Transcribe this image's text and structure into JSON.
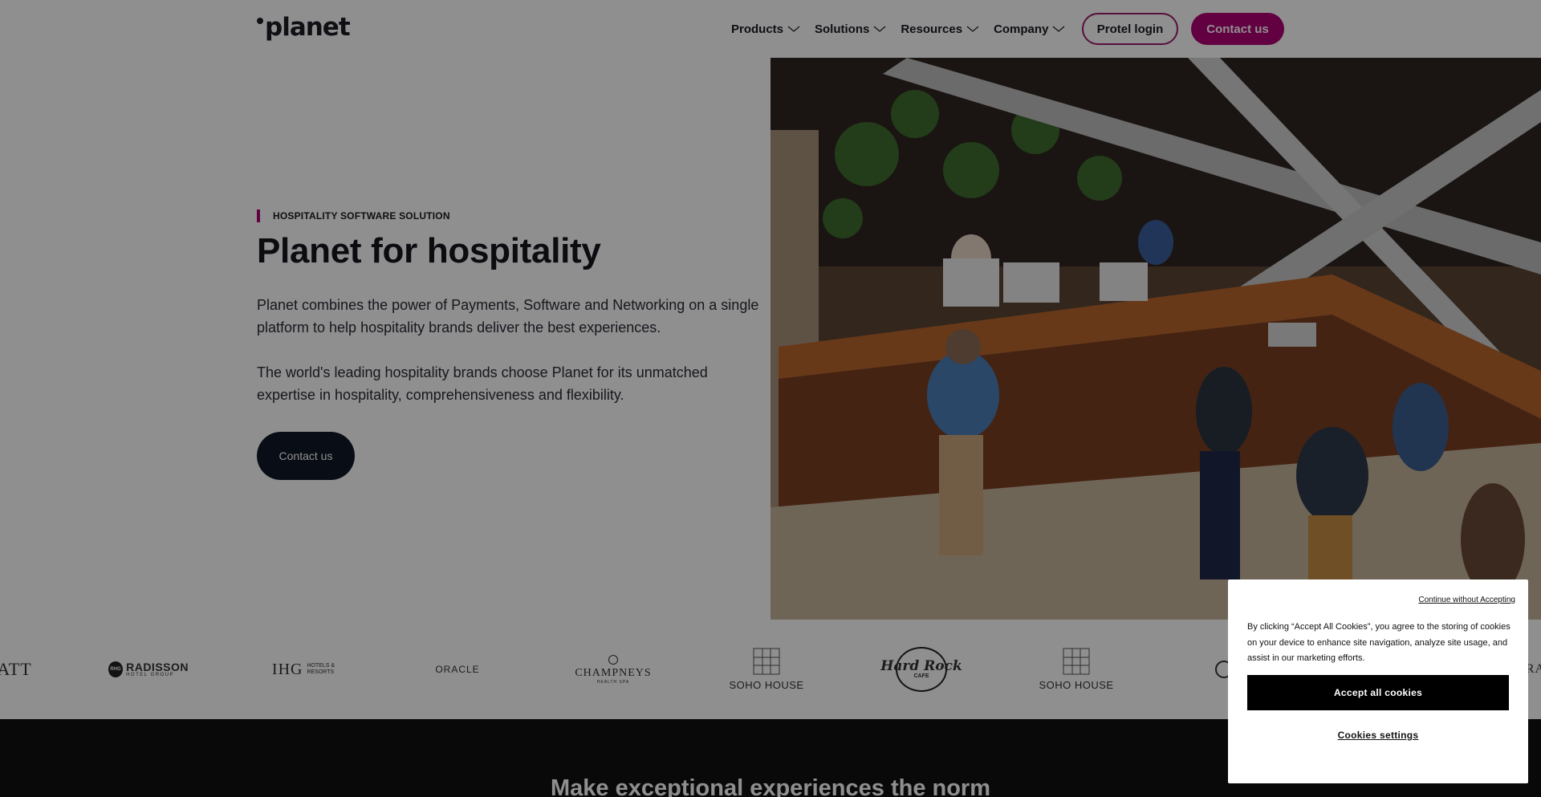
{
  "header": {
    "logo": "planet",
    "nav": [
      "Products",
      "Solutions",
      "Resources",
      "Company"
    ],
    "protel_login": "Protel login",
    "contact": "Contact us"
  },
  "hero": {
    "eyebrow": "HOSPITALITY SOFTWARE SOLUTION",
    "title": "Planet for hospitality",
    "p1": "Planet combines the power of Payments, Software and Networking on a single platform to help hospitality brands deliver the best experiences.",
    "p2": "The world's leading hospitality brands choose Planet for its unmatched expertise in hospitality, comprehensiveness and flexibility.",
    "cta": "Contact us"
  },
  "logos": {
    "hyatt_partial": "ATT",
    "radisson": "RADISSON",
    "radisson_sub": "HOTEL GROUP",
    "radisson_mark": "RHG",
    "ihg": "IHG",
    "ihg_sub1": "HOTELS &",
    "ihg_sub2": "RESORTS",
    "oracle": "ORACLE",
    "champneys": "CHAMPNEYS",
    "champneys_sub": "HEALTH SPA",
    "soho1": "SOHO HOUSE",
    "hardrock": "Hard Rock",
    "hardrock_sub": "CAFE",
    "soho2": "SOHO HOUSE",
    "last_partial": "RA"
  },
  "band": {
    "title": "Make exceptional experiences the norm"
  },
  "cookie": {
    "continue": "Continue without Accepting",
    "text": "By clicking “Accept All Cookies”, you agree to the storing of cookies on your device to enhance site navigation, analyze site usage, and assist in our marketing efforts.",
    "accept": "Accept all cookies",
    "settings": "Cookies settings"
  },
  "colors": {
    "brand": "#b00074",
    "dark_button": "#111827",
    "overlay": "rgba(0,0,0,0.44)"
  }
}
